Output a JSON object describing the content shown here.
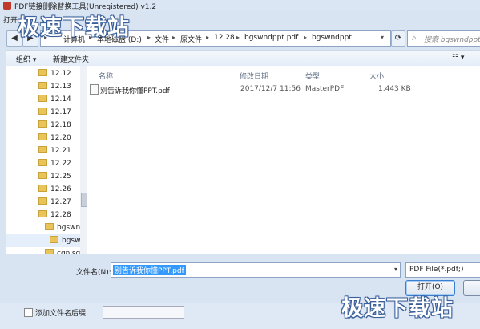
{
  "app": {
    "title": "PDF链接删除替换工具(Unregistered) v1.2",
    "bottom_checkbox_label": "添加文件名后缀"
  },
  "dialog": {
    "title": "打开"
  },
  "address": {
    "crumbs": [
      "计算机",
      "本地磁盘 (D:)",
      "文件",
      "原文件",
      "12.28",
      "bgswndppt  pdf",
      "bgswndppt"
    ],
    "search_placeholder": "搜索 bgswndppt"
  },
  "toolbar": {
    "organize_label": "组织 ▾",
    "new_folder_label": "新建文件夹"
  },
  "nav": {
    "items": [
      {
        "label": "12.12",
        "level": 0
      },
      {
        "label": "12.13",
        "level": 0
      },
      {
        "label": "12.14",
        "level": 0
      },
      {
        "label": "12.17",
        "level": 0
      },
      {
        "label": "12.18",
        "level": 0
      },
      {
        "label": "12.20",
        "level": 0
      },
      {
        "label": "12.21",
        "level": 0
      },
      {
        "label": "12.22",
        "level": 0
      },
      {
        "label": "12.25",
        "level": 0
      },
      {
        "label": "12.26",
        "level": 0
      },
      {
        "label": "12.27",
        "level": 0
      },
      {
        "label": "12.28",
        "level": 0
      },
      {
        "label": "bgswnc",
        "level": 1
      },
      {
        "label": "bgsw",
        "level": 2,
        "selected": true
      },
      {
        "label": "cgnjsq",
        "level": 1
      }
    ]
  },
  "list": {
    "columns": [
      "名称",
      "修改日期",
      "类型",
      "大小"
    ],
    "files": [
      {
        "name": "别告诉我你懂PPT.pdf",
        "modified": "2017/12/7 11:56",
        "type": "MasterPDF",
        "size": "1,443 KB"
      }
    ]
  },
  "form": {
    "filename_label": "文件名(N):",
    "filename_value": "别告诉我你懂PPT.pdf",
    "filter_value": "PDF File(*.pdf;)",
    "open_label": "打开(O)"
  },
  "watermark": {
    "text": "极速下载站"
  },
  "colors": {
    "accent": "#3399ff",
    "chrome": "#d8e4f2",
    "folder": "#e8c45a"
  }
}
